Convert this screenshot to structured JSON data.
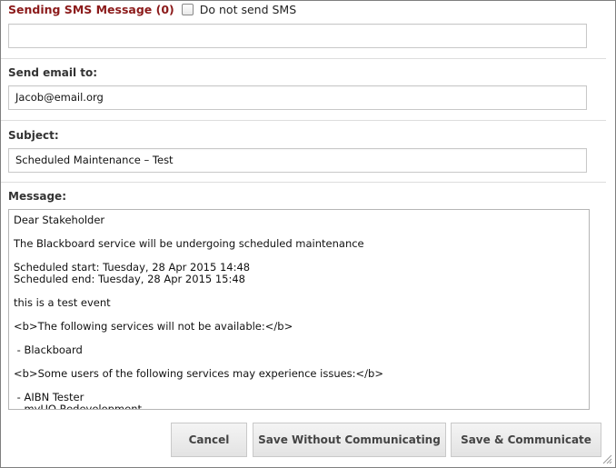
{
  "sms": {
    "title": "Sending SMS Message (0)",
    "do_not_send_label": "Do not send SMS",
    "do_not_send_checked": false,
    "value": ""
  },
  "email": {
    "label": "Send email to:",
    "value": "Jacob@email.org"
  },
  "subject": {
    "label": "Subject:",
    "value": "Scheduled Maintenance – Test"
  },
  "message": {
    "label": "Message:",
    "value": "Dear Stakeholder\n\nThe Blackboard service will be undergoing scheduled maintenance\n\nScheduled start: Tuesday, 28 Apr 2015 14:48\nScheduled end: Tuesday, 28 Apr 2015 15:48\n\nthis is a test event\n\n<b>The following services will not be available:</b>\n\n - Blackboard\n\n<b>Some users of the following services may experience issues:</b>\n\n - AIBN Tester\n - myUQ Redevelopment"
  },
  "buttons": {
    "cancel": "Cancel",
    "save_without": "Save Without Communicating",
    "save_communicate": "Save & Communicate"
  },
  "icons": {
    "resize": "resize-grip-icon",
    "checkbox": "checkbox-icon"
  },
  "colors": {
    "heading_red": "#8b1a1a",
    "button_bg": "#ebebeb"
  }
}
